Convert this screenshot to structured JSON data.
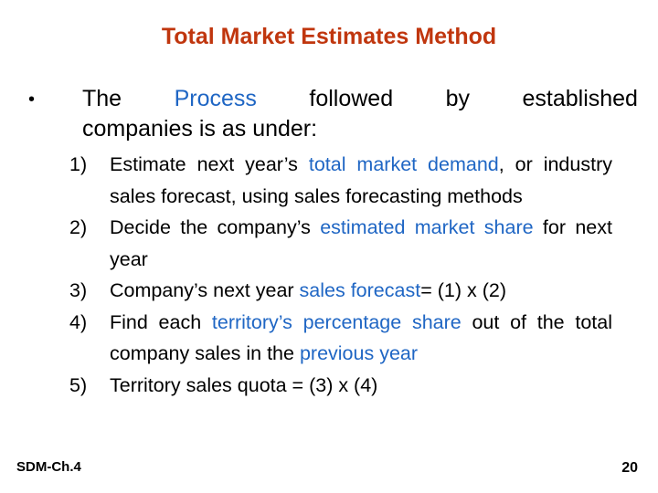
{
  "slide": {
    "title": "Total Market Estimates Method",
    "bullet": {
      "symbol": "•",
      "line1_words": [
        "The",
        "Process",
        "followed",
        "by",
        "established"
      ],
      "line1_highlight_index": 1,
      "line2": "companies is as under:"
    },
    "steps": [
      {
        "num": "1)",
        "parts": [
          {
            "text": "Estimate next year’s ",
            "hl": false
          },
          {
            "text": "total market demand",
            "hl": true
          },
          {
            "text": ", or industry sales forecast, using sales forecasting methods",
            "hl": false
          }
        ]
      },
      {
        "num": "2)",
        "parts": [
          {
            "text": "Decide the company’s ",
            "hl": false
          },
          {
            "text": "estimated market share",
            "hl": true
          },
          {
            "text": " for next year",
            "hl": false
          }
        ]
      },
      {
        "num": "3)",
        "parts": [
          {
            "text": "Company’s next year ",
            "hl": false
          },
          {
            "text": "sales forecast",
            "hl": true
          },
          {
            "text": "= (1) x (2)",
            "hl": false
          }
        ]
      },
      {
        "num": "4)",
        "parts": [
          {
            "text": "Find each ",
            "hl": false
          },
          {
            "text": "territory’s percentage share",
            "hl": true
          },
          {
            "text": " out of the total company sales in the ",
            "hl": false
          },
          {
            "text": "previous year",
            "hl": true
          }
        ]
      },
      {
        "num": "5)",
        "parts": [
          {
            "text": "Territory sales quota = (3) x (4)",
            "hl": false
          }
        ]
      }
    ],
    "footer_left": "SDM-Ch.4",
    "page_number": "20",
    "colors": {
      "title": "#c0360e",
      "highlight": "#1f66c4",
      "text": "#000000"
    }
  }
}
